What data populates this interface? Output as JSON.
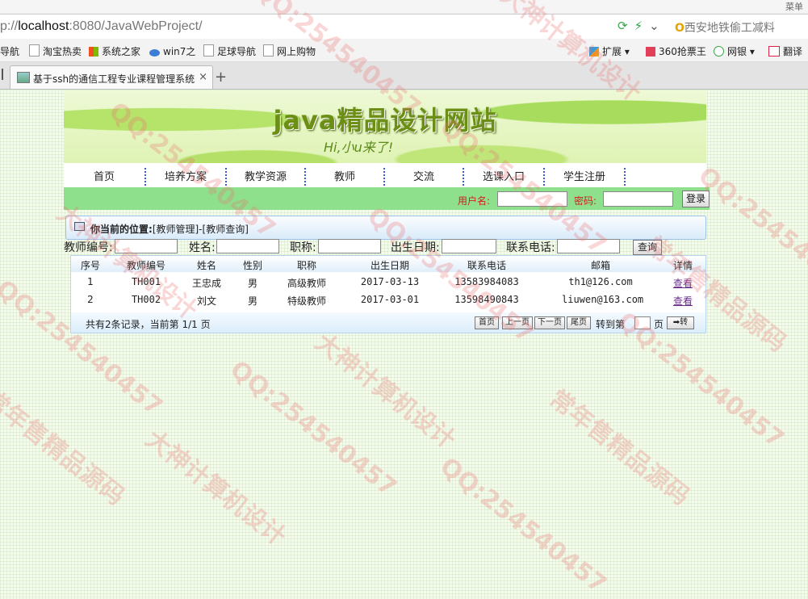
{
  "browser": {
    "top_right": "菜单",
    "address": {
      "prefix": "p://",
      "host": "localhost",
      "rest": ":8080/JavaWebProject/"
    },
    "search_text": "西安地铁偷工减料",
    "bookmarks": [
      {
        "label": "导航",
        "icon": "page-icon"
      },
      {
        "label": "淘宝热卖",
        "icon": "page-icon"
      },
      {
        "label": "系统之家",
        "icon": "windows-icon"
      },
      {
        "label": "win7之",
        "icon": "pc-icon"
      },
      {
        "label": "足球导航",
        "icon": "page-icon"
      },
      {
        "label": "网上购物",
        "icon": "page-icon"
      }
    ],
    "toolbar_right": [
      {
        "label": "扩展",
        "icon": "extension-icon"
      },
      {
        "label": "360抢票王",
        "icon": "ticket-icon"
      },
      {
        "label": "网银",
        "icon": "yen-icon"
      },
      {
        "label": "翻译",
        "icon": "translate-icon"
      }
    ],
    "tab_title": "基于ssh的通信工程专业课程管理系统",
    "tab_close": "×",
    "new_tab": "+"
  },
  "banner": {
    "title": "java精品设计网站",
    "subtitle": "Hi,小u来了!"
  },
  "nav": [
    "首页",
    "培养方案",
    "教学资源",
    "教师",
    "交流",
    "选课入口",
    "学生注册"
  ],
  "login": {
    "username_label": "用户名:",
    "password_label": "密码:",
    "button": "登录"
  },
  "location": {
    "label": "你当前的位置:",
    "path": "[教师管理]-[教师查询]"
  },
  "search": {
    "fields": [
      "教师编号:",
      "姓名:",
      "职称:",
      "出生日期:",
      "联系电话:"
    ],
    "button": "查询"
  },
  "table": {
    "headers": [
      "序号",
      "教师编号",
      "姓名",
      "性别",
      "职称",
      "出生日期",
      "联系电话",
      "邮箱",
      "详情"
    ],
    "rows": [
      [
        "1",
        "TH001",
        "王忠成",
        "男",
        "高级教师",
        "2017-03-13",
        "13583984083",
        "th1@126.com",
        "查看"
      ],
      [
        "2",
        "TH002",
        "刘文",
        "男",
        "特级教师",
        "2017-03-01",
        "13598490843",
        "liuwen@163.com",
        "查看"
      ]
    ],
    "footer": "共有2条记录，当前第 1/1 页",
    "pager": [
      "首页",
      "上一页",
      "下一页",
      "尾页"
    ],
    "goto_label": "转到第",
    "page_label": "页",
    "go_button": "➡转"
  },
  "watermarks": [
    "QQ:254540457",
    "大神计算机设计",
    "常年售精品源码"
  ]
}
